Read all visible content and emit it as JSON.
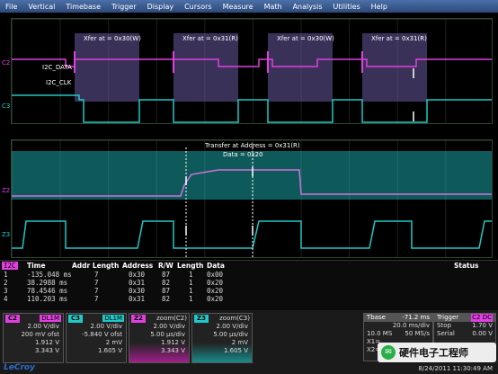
{
  "menu": [
    "File",
    "Vertical",
    "Timebase",
    "Trigger",
    "Display",
    "Cursors",
    "Measure",
    "Math",
    "Analysis",
    "Utilities",
    "Help"
  ],
  "upper": {
    "annotations": [
      "Xfer at = 0x30(W)",
      "Xfer at = 0x31(R)",
      "Xfer at = 0x30(W)",
      "Xfer at = 0x31(R)"
    ],
    "data_label": "I2C_DATA",
    "clk_label": "I2C_CLK",
    "ch_a": "C2",
    "ch_b": "C3"
  },
  "lower": {
    "annotation": "Transfer at Address = 0x31(R)",
    "data_annotation": "Data = 0x20",
    "label_a": "Z2",
    "label_b": "Z3"
  },
  "table": {
    "tag": "I2C",
    "headers": [
      "Time",
      "Addr Length",
      "Address",
      "R/W",
      "Length",
      "Data",
      "Status"
    ],
    "rows": [
      {
        "idx": "1",
        "time": "-135.048 ms",
        "addr_len": "7",
        "address": "0x30",
        "rw": "87",
        "length": "1",
        "data": "0x00"
      },
      {
        "idx": "2",
        "time": "38.2988 ms",
        "addr_len": "7",
        "address": "0x31",
        "rw": "82",
        "length": "1",
        "data": "0x20"
      },
      {
        "idx": "3",
        "time": "78.4546 ms",
        "addr_len": "7",
        "address": "0x30",
        "rw": "87",
        "length": "1",
        "data": "0x20"
      },
      {
        "idx": "4",
        "time": "110.203 ms",
        "addr_len": "7",
        "address": "0x31",
        "rw": "82",
        "length": "1",
        "data": "0x20"
      }
    ]
  },
  "cards": [
    {
      "tag": "C2",
      "badge": "DL1M",
      "color": "#e040e0",
      "l1": "2.00 V/div",
      "l2": "200 mV ofst",
      "l3": "",
      "l4": "1.912 V",
      "l5": "3.343 V"
    },
    {
      "tag": "C3",
      "badge": "DL1M",
      "color": "#20c8c8",
      "l1": "2.00 V/div",
      "l2": "-5.840 V ofst",
      "l3": "",
      "l4": "2 mV",
      "l5": "1.605 V"
    },
    {
      "tag": "Z2",
      "badge": "zoom(C2)",
      "color": "#e040e0",
      "l1": "2.00 V/div",
      "l2": "5.00 µs/div",
      "l3": "",
      "l4": "1.912 V",
      "l5": "3.343 V"
    },
    {
      "tag": "Z3",
      "badge": "zoom(C3)",
      "color": "#20c8c8",
      "l1": "2.00 V/div",
      "l2": "5.00 µs/div",
      "l3": "",
      "l4": "2 mV",
      "l5": "1.605 V"
    }
  ],
  "timebase": {
    "label": "Tbase",
    "value": "-71.2 ms",
    "l2": "20.0 ms/div",
    "l3a": "10.0 MS",
    "l3b": "50 MS/s",
    "l4": "X1=",
    "l5": "X2="
  },
  "trigger": {
    "label": "Trigger",
    "badge": "C2 DC",
    "l2a": "Stop",
    "l2b": "1.70 V",
    "l3a": "Serial",
    "l3b": "0.00 V",
    "l4": "",
    "l5": ""
  },
  "brand": "LeCroy",
  "timestamp": "8/24/2011 11:30:49 AM",
  "watermark": "硬件电子工程师",
  "colors": {
    "magenta": "#e040e0",
    "cyan": "#20c8c8",
    "accent": "#ffd35a"
  }
}
